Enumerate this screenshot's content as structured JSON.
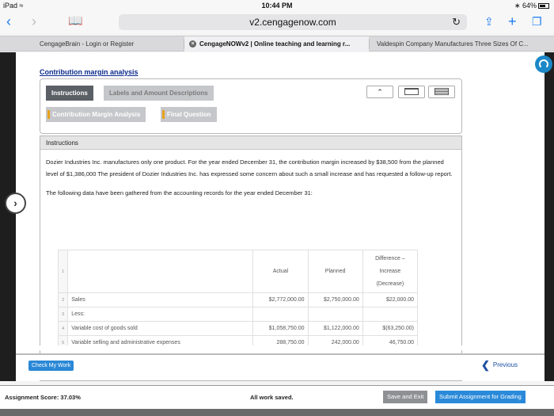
{
  "status": {
    "device": "iPad",
    "wifi": "wifi-icon",
    "time": "10:44 PM",
    "battery": "64%"
  },
  "browser": {
    "url": "v2.cengagenow.com",
    "tabs": [
      {
        "label": "CengageBrain - Login or Register"
      },
      {
        "label": "CengageNOWv2 | Online teaching and learning r..."
      },
      {
        "label": "Valdespin Company Manufactures Three Sizes Of C..."
      }
    ]
  },
  "page": {
    "title": "Contribution margin analysis",
    "tabs": [
      {
        "label": "Instructions"
      },
      {
        "label": "Labels and Amount Descriptions"
      },
      {
        "label": "Contribution Margin Analysis"
      },
      {
        "label": "Final Question"
      }
    ],
    "instructions_header": "Instructions",
    "paragraph1": "Dozier Industries Inc. manufactures only one product. For the year ended December 31, the contribution margin increased by $38,500 from the planned level of $1,386,000 The president of Dozier Industries Inc. has expressed some concern about such a small increase and has requested a follow-up report.",
    "paragraph2": "The following data have been gathered from the accounting records for the year ended December 31:"
  },
  "table": {
    "headers": {
      "actual": "Actual",
      "planned": "Planned",
      "diff1": "Difference –",
      "diff2": "Increase",
      "diff3": "(Decrease)"
    },
    "rows": [
      {
        "n": "1",
        "label": "",
        "actual": "",
        "planned": ""
      },
      {
        "n": "2",
        "label": "Sales",
        "actual": "$2,772,000.00",
        "planned": "$2,750,000.00",
        "diff": "$22,000.00"
      },
      {
        "n": "3",
        "label": "Less:",
        "actual": "",
        "planned": "",
        "diff": ""
      },
      {
        "n": "4",
        "label": "Variable cost of goods sold",
        "actual": "$1,058,750.00",
        "planned": "$1,122,000.00",
        "diff": "$(63,250.00)"
      },
      {
        "n": "5",
        "label": "Variable selling and administrative expenses",
        "actual": "288,750.00",
        "planned": "242,000.00",
        "diff": "46,750.00"
      }
    ]
  },
  "footer": {
    "check_work": "Check My Work",
    "previous": "Previous",
    "score": "Assignment Score: 37.03%",
    "saved": "All work saved.",
    "save_exit": "Save and Exit",
    "submit": "Submit Assignment for Grading"
  }
}
